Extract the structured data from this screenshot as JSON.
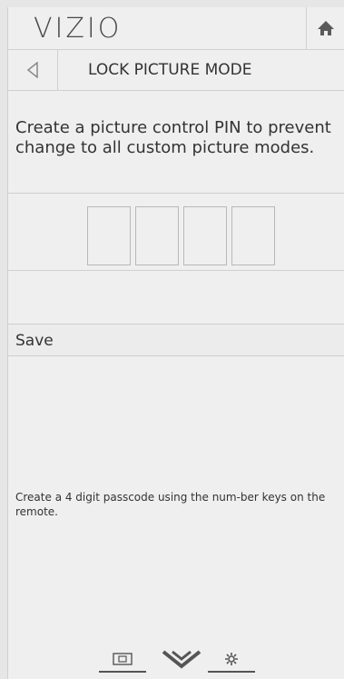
{
  "app": {
    "logo": "VIZIO",
    "title": "LOCK PICTURE MODE"
  },
  "icons": {
    "home": "home-icon",
    "back": "back-triangle-icon",
    "input": "input-icon",
    "vizio_chevron": "vizio-chevron-icon",
    "settings": "gear-icon"
  },
  "main": {
    "description": "Create a picture control PIN to prevent change to all custom picture modes.",
    "pin_digits": [
      "",
      "",
      "",
      ""
    ],
    "save_label": "Save",
    "help_text": "Create a 4 digit passcode using the num-ber keys on the remote."
  },
  "colors": {
    "background": "#efefef",
    "divider": "#d0d0d0",
    "text": "#333333"
  }
}
